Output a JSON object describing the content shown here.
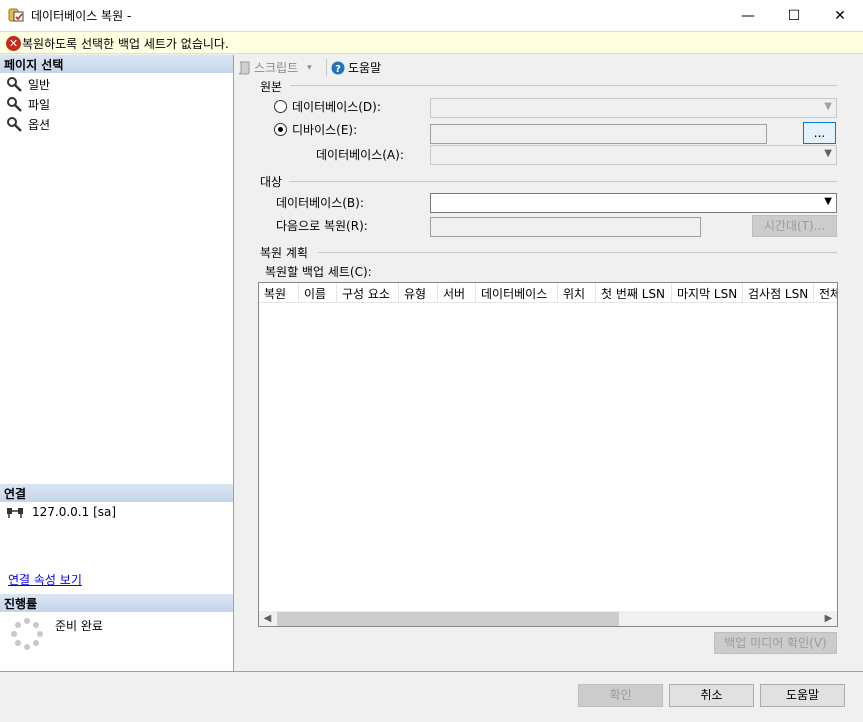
{
  "window": {
    "title": "데이터베이스 복원 -",
    "minimize_glyph": "—",
    "maximize_glyph": "☐",
    "close_glyph": "✕"
  },
  "error_banner": {
    "message": "복원하도록 선택한 백업 세트가 없습니다."
  },
  "left": {
    "page_select_header": "페이지 선택",
    "pages": [
      {
        "label": "일반"
      },
      {
        "label": "파일"
      },
      {
        "label": "옵션"
      }
    ],
    "connection_header": "연결",
    "connection_value": "127.0.0.1 [sa]",
    "connection_link": "연결 속성 보기",
    "progress_header": "진행률",
    "progress_status": "준비 완료"
  },
  "toolbar": {
    "script_label": "스크립트",
    "help_label": "도움말"
  },
  "source": {
    "group_label": "원본",
    "database_radio": "데이터베이스(D):",
    "device_radio": "디바이스(E):",
    "browse_label": "...",
    "device_database_label": "데이터베이스(A):"
  },
  "destination": {
    "group_label": "대상",
    "database_label": "데이터베이스(B):",
    "restore_to_label": "다음으로 복원(R):",
    "timeline_button": "시간대(T)..."
  },
  "plan": {
    "group_label": "복원 계획",
    "backup_sets_label": "복원할 백업 세트(C):",
    "columns": [
      "복원",
      "이름",
      "구성 요소",
      "유형",
      "서버",
      "데이터베이스",
      "위치",
      "첫 번째 LSN",
      "마지막 LSN",
      "검사점 LSN",
      "전체"
    ],
    "verify_button": "백업 미디어 확인(V)"
  },
  "footer": {
    "ok_label": "확인",
    "cancel_label": "취소",
    "help_label": "도움말"
  },
  "colors": {
    "accent": "#0078d7",
    "error": "#c42b1c",
    "banner_bg": "#ffffe1",
    "header_gradient_top": "#dbe6f4"
  }
}
